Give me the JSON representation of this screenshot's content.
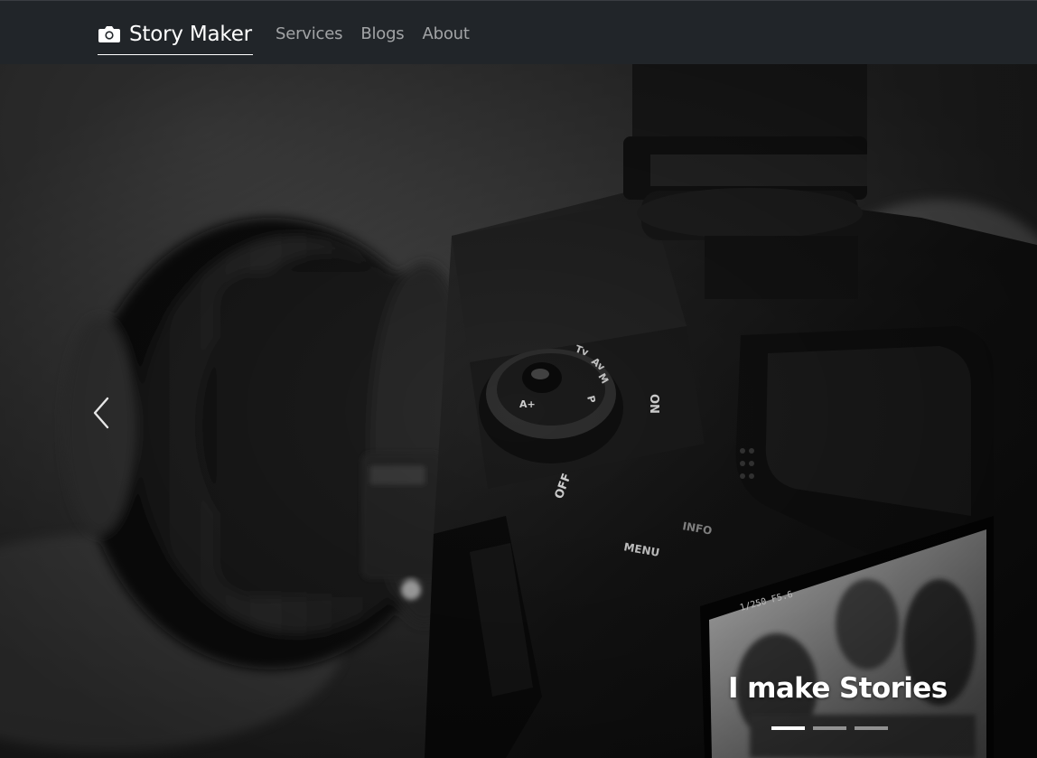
{
  "navbar": {
    "brand": {
      "icon": "camera-icon",
      "label": "Story Maker"
    },
    "links": [
      {
        "label": "Services"
      },
      {
        "label": "Blogs"
      },
      {
        "label": "About"
      }
    ]
  },
  "carousel": {
    "caption": "I make Stories",
    "prev_icon": "chevron-left-icon",
    "active_index": 0,
    "slide_count": 3,
    "camera_markings": [
      "OFF",
      "ON",
      "MENU",
      "INFO",
      "M",
      "Av",
      "Tv",
      "P",
      "A+"
    ]
  },
  "colors": {
    "navbar_bg": "#212529",
    "nav_link": "rgba(255,255,255,0.58)",
    "brand": "#ffffff"
  }
}
